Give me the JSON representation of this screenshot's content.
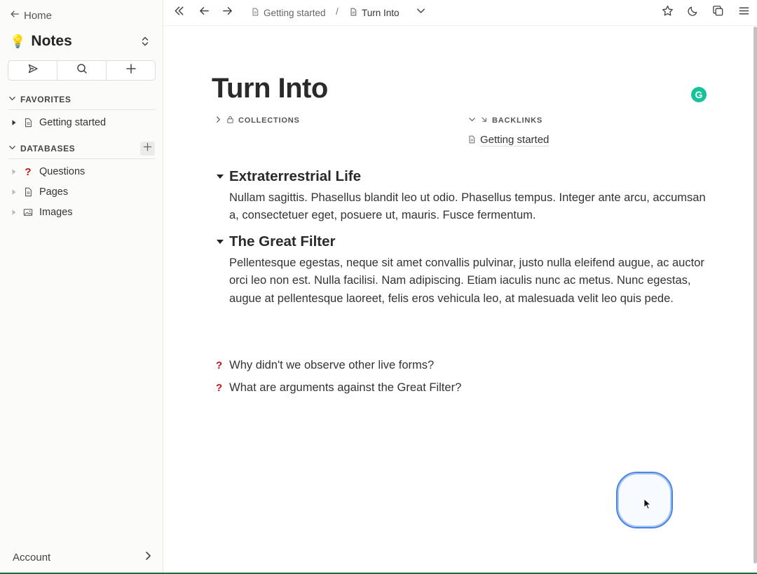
{
  "sidebar": {
    "home_label": "Home",
    "workspace_icon": "💡",
    "workspace_title": "Notes",
    "favorites_header": "FAVORITES",
    "favorites": [
      {
        "label": "Getting started",
        "icon": "document-icon"
      }
    ],
    "databases_header": "DATABASES",
    "databases": [
      {
        "label": "Questions",
        "icon": "question-icon"
      },
      {
        "label": "Pages",
        "icon": "document-icon"
      },
      {
        "label": "Images",
        "icon": "image-icon"
      }
    ],
    "account_label": "Account"
  },
  "topbar": {
    "breadcrumb_parent": "Getting started",
    "breadcrumb_separator": "/",
    "breadcrumb_current": "Turn Into"
  },
  "page": {
    "title": "Turn Into",
    "grammarly_letter": "G",
    "collections_label": "COLLECTIONS",
    "backlinks_label": "BACKLINKS",
    "backlinks": [
      {
        "label": "Getting started"
      }
    ],
    "sections": [
      {
        "heading": "Extraterrestrial Life",
        "body": "Nullam sagittis. Phasellus blandit leo ut odio. Phasellus tempus. Integer ante arcu, accumsan a, consectetuer eget, posuere ut, mauris. Fusce fermentum."
      },
      {
        "heading": "The Great Filter",
        "body": "Pellentesque egestas, neque sit amet convallis pulvinar, justo nulla eleifend augue, ac auctor orci leo non est. Nulla facilisi. Nam adipiscing. Etiam iaculis nunc ac metus. Nunc egestas, augue at pellentesque laoreet, felis eros vehicula leo, at malesuada velit leo quis pede."
      }
    ],
    "questions": [
      {
        "mark": "?",
        "label": "Why didn't we observe other live forms?"
      },
      {
        "mark": "?",
        "label": "What are arguments against the Great Filter?"
      }
    ]
  },
  "colors": {
    "question_mark": "#c0141b",
    "grammarly": "#15c39a",
    "cursor_ring": "#4a86e0"
  }
}
